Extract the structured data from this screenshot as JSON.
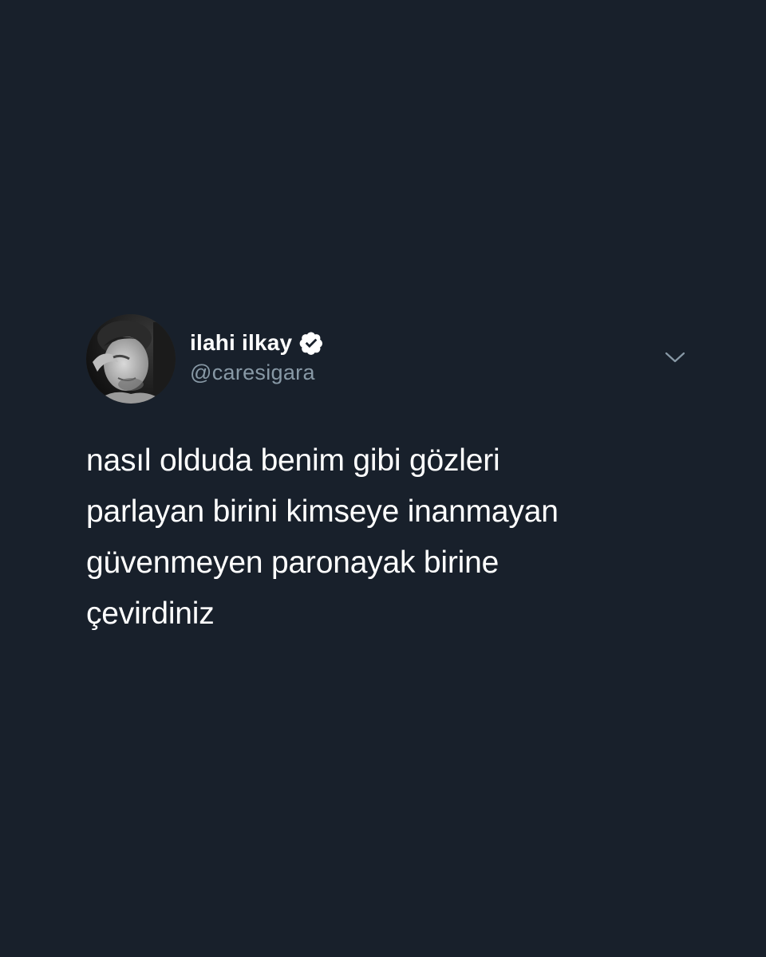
{
  "colors": {
    "background": "#18202b",
    "text_primary": "#ffffff",
    "text_secondary": "#8899a6",
    "verified_badge": "#ffffff",
    "chevron": "#8899a6"
  },
  "tweet": {
    "author": {
      "display_name": "ilahi ilkay",
      "handle": "@caresigara",
      "verified_icon": "verified-check-icon",
      "avatar_icon": "profile-avatar"
    },
    "menu_icon": "chevron-down-icon",
    "text_lines": [
      "nasıl olduda benim gibi gözleri",
      "parlayan birini kimseye inanmayan",
      "güvenmeyen paronayak birine",
      "çevirdiniz"
    ]
  }
}
